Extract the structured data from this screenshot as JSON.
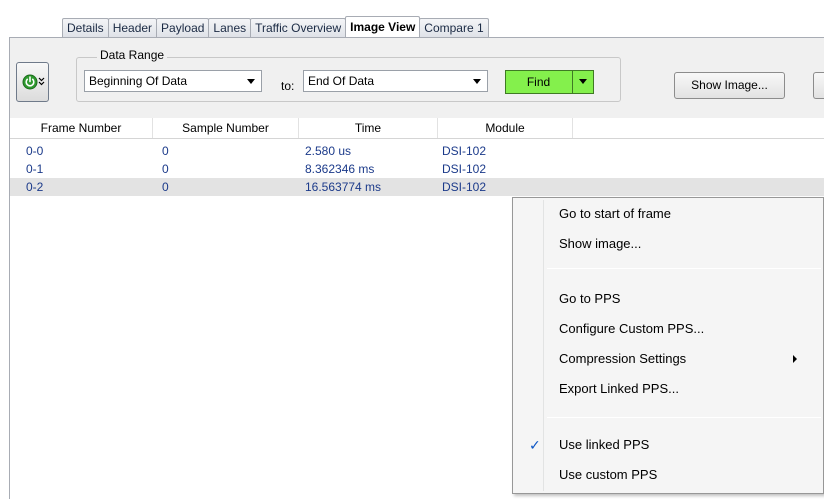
{
  "tabs": [
    "Details",
    "Header",
    "Payload",
    "Lanes",
    "Traffic Overview",
    "Image View",
    "Compare 1"
  ],
  "active_tab": "Image View",
  "toolbar": {
    "data_range_label": "Data Range",
    "from_value": "Beginning Of Data",
    "to_label": "to:",
    "to_value": "End Of Data",
    "find_label": "Find",
    "show_image_label": "Show Image...",
    "find_color": "#84f04c",
    "power_icon_color": "#2e9a2e"
  },
  "table": {
    "columns": [
      "Frame Number",
      "Sample Number",
      "Time",
      "Module"
    ],
    "rows": [
      [
        "0-0",
        "0",
        "2.580 us",
        "DSI-102"
      ],
      [
        "0-1",
        "0",
        "8.362346 ms",
        "DSI-102"
      ],
      [
        "0-2",
        "0",
        "16.563774 ms",
        "DSI-102"
      ]
    ],
    "selected_row": 2
  },
  "context_menu": {
    "items": [
      {
        "label": "Go to start of frame"
      },
      {
        "label": "Show image..."
      },
      {
        "label": "Go to PPS"
      },
      {
        "label": "Configure Custom PPS..."
      },
      {
        "label": "Compression Settings",
        "submenu": true
      },
      {
        "label": "Export Linked PPS..."
      },
      {
        "label": "Use linked PPS",
        "checked": true
      },
      {
        "label": "Use custom PPS"
      }
    ]
  }
}
